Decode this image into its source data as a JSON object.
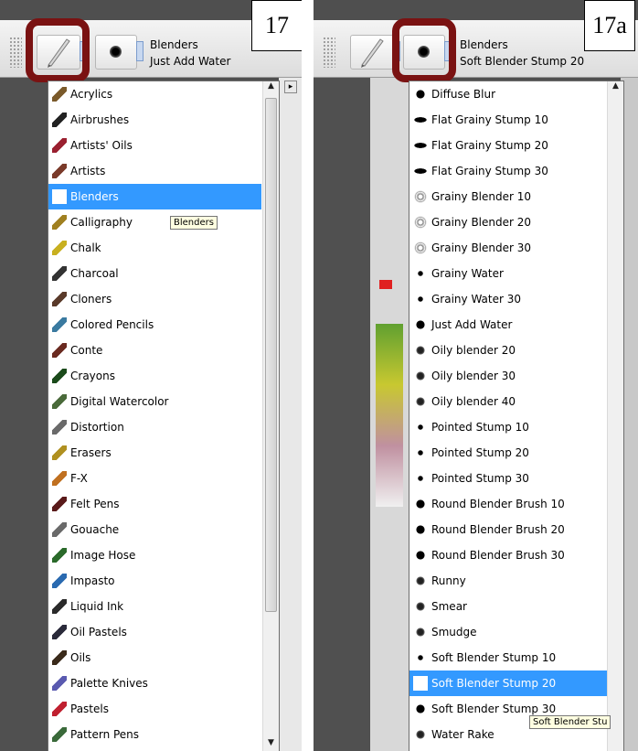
{
  "left_panel": {
    "figure_label": "17",
    "category_title": "Blenders",
    "variant_title": "Just Add Water",
    "tooltip": "Blenders",
    "selected_index": 4,
    "items": [
      {
        "label": "Acrylics",
        "icon": "acrylics-brush-icon",
        "color": "#7a5a2a"
      },
      {
        "label": "Airbrushes",
        "icon": "airbrush-icon",
        "color": "#222222"
      },
      {
        "label": "Artists' Oils",
        "icon": "artists-oils-icon",
        "color": "#9a2030"
      },
      {
        "label": "Artists",
        "icon": "artists-brush-icon",
        "color": "#7a3a2a"
      },
      {
        "label": "Blenders",
        "icon": "blender-stump-icon",
        "color": "#9a9a9a"
      },
      {
        "label": "Calligraphy",
        "icon": "calligraphy-pen-icon",
        "color": "#a08020"
      },
      {
        "label": "Chalk",
        "icon": "chalk-icon",
        "color": "#c8b020"
      },
      {
        "label": "Charcoal",
        "icon": "charcoal-icon",
        "color": "#333333"
      },
      {
        "label": "Cloners",
        "icon": "cloner-stamp-icon",
        "color": "#5a3a2a"
      },
      {
        "label": "Colored Pencils",
        "icon": "colored-pencil-icon",
        "color": "#3a7aa0"
      },
      {
        "label": "Conte",
        "icon": "conte-icon",
        "color": "#6a2a20"
      },
      {
        "label": "Crayons",
        "icon": "crayon-icon",
        "color": "#1a4a1a"
      },
      {
        "label": "Digital Watercolor",
        "icon": "digital-watercolor-icon",
        "color": "#4a6a3a"
      },
      {
        "label": "Distortion",
        "icon": "distortion-icon",
        "color": "#6a6a6a"
      },
      {
        "label": "Erasers",
        "icon": "eraser-icon",
        "color": "#b09020"
      },
      {
        "label": "F-X",
        "icon": "fx-icon",
        "color": "#c07020"
      },
      {
        "label": "Felt Pens",
        "icon": "felt-pen-icon",
        "color": "#5a1a1a"
      },
      {
        "label": "Gouache",
        "icon": "gouache-icon",
        "color": "#6a6a6a"
      },
      {
        "label": "Image Hose",
        "icon": "image-hose-icon",
        "color": "#2a6a2a"
      },
      {
        "label": "Impasto",
        "icon": "impasto-icon",
        "color": "#2a6ab0"
      },
      {
        "label": "Liquid Ink",
        "icon": "liquid-ink-icon",
        "color": "#2a2a2a"
      },
      {
        "label": "Oil Pastels",
        "icon": "oil-pastel-icon",
        "color": "#2a2a3a"
      },
      {
        "label": "Oils",
        "icon": "oils-brush-icon",
        "color": "#3a2a1a"
      },
      {
        "label": "Palette Knives",
        "icon": "palette-knife-icon",
        "color": "#5a5ab0"
      },
      {
        "label": "Pastels",
        "icon": "pastel-icon",
        "color": "#c02030"
      },
      {
        "label": "Pattern Pens",
        "icon": "pattern-pen-icon",
        "color": "#3a6a3a"
      }
    ]
  },
  "right_panel": {
    "figure_label": "17a",
    "category_title": "Blenders",
    "variant_title": "Soft Blender Stump 20",
    "tooltip": "Soft Blender Stu",
    "selected_index": 23,
    "items": [
      {
        "label": "Diffuse Blur",
        "icon": "round-dab-icon"
      },
      {
        "label": "Flat Grainy Stump 10",
        "icon": "flat-dab-icon"
      },
      {
        "label": "Flat Grainy Stump 20",
        "icon": "flat-dab-icon"
      },
      {
        "label": "Flat Grainy Stump 30",
        "icon": "flat-dab-icon"
      },
      {
        "label": "Grainy Blender 10",
        "icon": "speckled-dab-icon"
      },
      {
        "label": "Grainy Blender 20",
        "icon": "speckled-dab-icon"
      },
      {
        "label": "Grainy Blender 30",
        "icon": "speckled-dab-icon"
      },
      {
        "label": "Grainy Water",
        "icon": "small-dab-icon"
      },
      {
        "label": "Grainy Water 30",
        "icon": "small-dab-icon"
      },
      {
        "label": "Just Add Water",
        "icon": "round-dab-icon"
      },
      {
        "label": "Oily blender 20",
        "icon": "grainy-dab-icon"
      },
      {
        "label": "Oily blender 30",
        "icon": "grainy-dab-icon"
      },
      {
        "label": "Oily blender 40",
        "icon": "grainy-dab-icon"
      },
      {
        "label": "Pointed Stump 10",
        "icon": "small-dab-icon"
      },
      {
        "label": "Pointed Stump 20",
        "icon": "small-dab-icon"
      },
      {
        "label": "Pointed Stump 30",
        "icon": "small-dab-icon"
      },
      {
        "label": "Round Blender Brush 10",
        "icon": "round-dab-icon"
      },
      {
        "label": "Round Blender Brush 20",
        "icon": "round-dab-icon"
      },
      {
        "label": "Round Blender Brush 30",
        "icon": "round-dab-icon"
      },
      {
        "label": "Runny",
        "icon": "grainy-dab-icon"
      },
      {
        "label": "Smear",
        "icon": "grainy-dab-icon"
      },
      {
        "label": "Smudge",
        "icon": "grainy-dab-icon"
      },
      {
        "label": "Soft Blender Stump 10",
        "icon": "small-dab-icon"
      },
      {
        "label": "Soft Blender Stump 20",
        "icon": "round-dab-icon"
      },
      {
        "label": "Soft Blender Stump 30",
        "icon": "round-dab-icon"
      },
      {
        "label": "Water Rake",
        "icon": "grainy-dab-icon"
      }
    ]
  }
}
